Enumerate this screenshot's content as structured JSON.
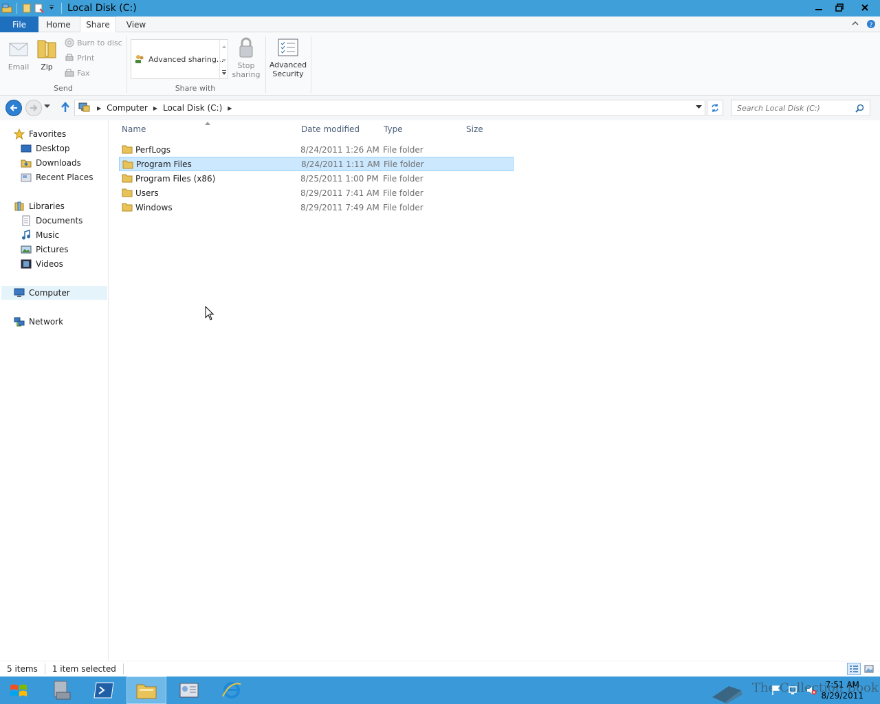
{
  "window": {
    "title": "Local Disk (C:)"
  },
  "tabs": {
    "file": "File",
    "home": "Home",
    "share": "Share",
    "view": "View"
  },
  "ribbon": {
    "email": "Email",
    "zip": "Zip",
    "burn": "Burn to disc",
    "print": "Print",
    "fax": "Fax",
    "send_group": "Send",
    "advanced_sharing": "Advanced sharing...",
    "share_group": "Share with",
    "stop_sharing_1": "Stop",
    "stop_sharing_2": "sharing",
    "advanced_security_1": "Advanced",
    "advanced_security_2": "Security"
  },
  "address": {
    "crumbs": [
      "Computer",
      "Local Disk (C:)"
    ],
    "search_placeholder": "Search Local Disk (C:)"
  },
  "nav": {
    "favorites": "Favorites",
    "desktop": "Desktop",
    "downloads": "Downloads",
    "recent": "Recent Places",
    "libraries": "Libraries",
    "documents": "Documents",
    "music": "Music",
    "pictures": "Pictures",
    "videos": "Videos",
    "computer": "Computer",
    "network": "Network"
  },
  "columns": {
    "name": "Name",
    "date": "Date modified",
    "type": "Type",
    "size": "Size"
  },
  "files": [
    {
      "name": "PerfLogs",
      "date": "8/24/2011 1:26 AM",
      "type": "File folder"
    },
    {
      "name": "Program Files",
      "date": "8/24/2011 1:11 AM",
      "type": "File folder"
    },
    {
      "name": "Program Files (x86)",
      "date": "8/25/2011 1:00 PM",
      "type": "File folder"
    },
    {
      "name": "Users",
      "date": "8/29/2011 7:41 AM",
      "type": "File folder"
    },
    {
      "name": "Windows",
      "date": "8/29/2011 7:49 AM",
      "type": "File folder"
    }
  ],
  "status": {
    "items": "5 items",
    "selected": "1 item selected"
  },
  "clock": {
    "time": "7:51 AM",
    "date": "8/29/2011"
  },
  "watermark": "The Collection Book",
  "colors": {
    "titlebar": "#3fa0d9",
    "file_tab": "#1f6fbf",
    "selection": "#cce8ff",
    "taskbar": "#3a9ad9"
  }
}
